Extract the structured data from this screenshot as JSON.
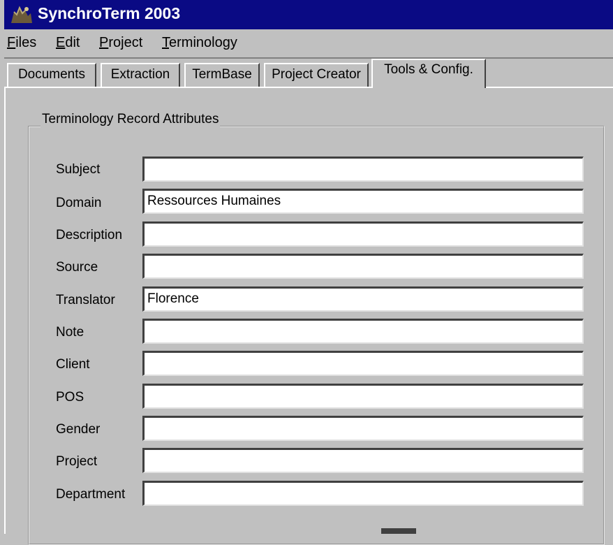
{
  "window": {
    "title": "SynchroTerm 2003"
  },
  "menu": [
    {
      "accel": "F",
      "rest": "iles"
    },
    {
      "accel": "E",
      "rest": "dit"
    },
    {
      "accel": "P",
      "rest": "roject"
    },
    {
      "accel": "T",
      "rest": "erminology"
    }
  ],
  "tabs": [
    "Documents",
    "Extraction",
    "TermBase",
    "Project Creator",
    "Tools & Config."
  ],
  "active_tab": "Tools & Config.",
  "group": {
    "title": "Terminology Record Attributes",
    "fields": [
      {
        "label": "Subject",
        "value": ""
      },
      {
        "label": "Domain",
        "value": "Ressources Humaines"
      },
      {
        "label": "Description",
        "value": ""
      },
      {
        "label": "Source",
        "value": ""
      },
      {
        "label": "Translator",
        "value": "Florence"
      },
      {
        "label": "Note",
        "value": ""
      },
      {
        "label": "Client",
        "value": ""
      },
      {
        "label": "POS",
        "value": ""
      },
      {
        "label": "Gender",
        "value": ""
      },
      {
        "label": "Project",
        "value": ""
      },
      {
        "label": "Department",
        "value": ""
      }
    ]
  },
  "colors": {
    "titlebar": "#0a0a84",
    "face": "#c0c0c0",
    "field": "#ffffff"
  },
  "icons": {
    "app": "synchroterm-app-icon"
  }
}
